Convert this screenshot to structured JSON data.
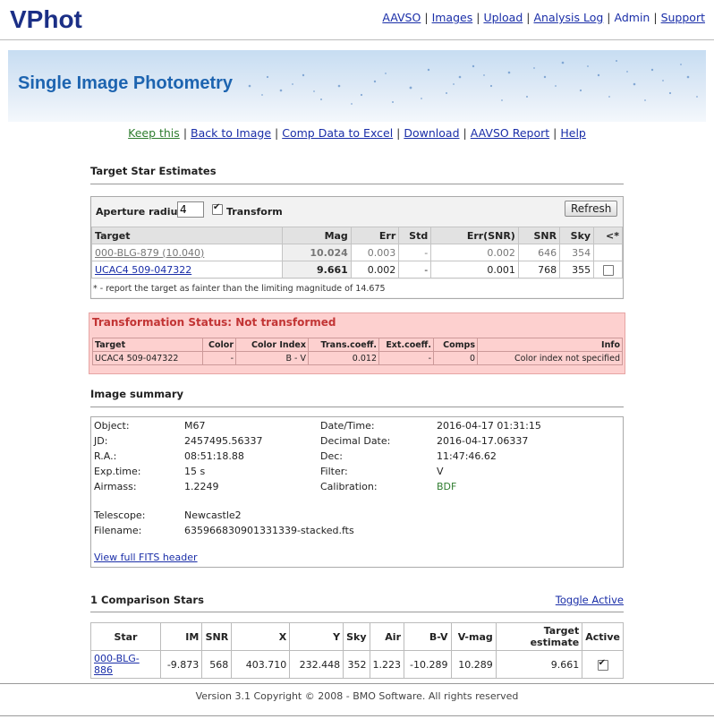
{
  "app": {
    "logo": "VPhot",
    "nav": [
      {
        "label": "AAVSO",
        "link": true
      },
      {
        "label": "Images",
        "link": true
      },
      {
        "label": "Upload",
        "link": true
      },
      {
        "label": "Analysis Log",
        "link": true
      },
      {
        "label": "Admin",
        "link": false
      },
      {
        "label": "Support",
        "link": true
      }
    ]
  },
  "banner": {
    "title": "Single Image Photometry"
  },
  "subnav": [
    "Keep this",
    "Back to Image",
    "Comp Data to Excel",
    "Download",
    "AAVSO Report",
    "Help"
  ],
  "target_section": {
    "title": "Target Star Estimates",
    "aperture_label": "Aperture radius:",
    "aperture_value": "4",
    "transform_label": "Transform",
    "transform_checked": true,
    "refresh_label": "Refresh",
    "columns": [
      "Target",
      "Mag",
      "Err",
      "Std",
      "Err(SNR)",
      "SNR",
      "Sky",
      "<*"
    ],
    "rows": [
      {
        "target": "000-BLG-879 (10.040)",
        "mag": "10.024",
        "err": "0.003",
        "std": "-",
        "err_snr": "0.002",
        "snr": "646",
        "sky": "354",
        "check": false
      },
      {
        "target": "UCAC4 509-047322",
        "mag": "9.661",
        "err": "0.002",
        "std": "-",
        "err_snr": "0.001",
        "snr": "768",
        "sky": "355",
        "check": true
      }
    ],
    "footnote": "* - report the target as fainter than the limiting magnitude of 14.675"
  },
  "transformation": {
    "title": "Transformation Status: Not transformed",
    "columns": [
      "Target",
      "Color",
      "Color Index",
      "Trans.coeff.",
      "Ext.coeff.",
      "Comps",
      "Info"
    ],
    "row": {
      "target": "UCAC4 509-047322",
      "color": "-",
      "color_index": "B - V",
      "trans": "0.012",
      "ext": "-",
      "comps": "0",
      "info": "Color index not specified"
    }
  },
  "summary": {
    "title": "Image summary",
    "left": [
      {
        "k": "Object:",
        "v": "M67"
      },
      {
        "k": "JD:",
        "v": "2457495.56337"
      },
      {
        "k": "R.A.:",
        "v": "08:51:18.88"
      },
      {
        "k": "Exp.time:",
        "v": "15 s"
      },
      {
        "k": "Airmass:",
        "v": "1.2249"
      }
    ],
    "right": [
      {
        "k": "Date/Time:",
        "v": "2016-04-17 01:31:15"
      },
      {
        "k": "Decimal Date:",
        "v": "2016-04-17.06337"
      },
      {
        "k": "Dec:",
        "v": "11:47:46.62"
      },
      {
        "k": "Filter:",
        "v": "V"
      },
      {
        "k": "Calibration:",
        "v": "BDF"
      }
    ],
    "telescope_label": "Telescope:",
    "telescope": "Newcastle2",
    "filename_label": "Filename:",
    "filename": "635966830901331339-stacked.fts",
    "fits_link": "View full FITS header"
  },
  "comparison": {
    "title": "1 Comparison Stars",
    "toggle": "Toggle Active",
    "columns": [
      "Star",
      "IM",
      "SNR",
      "X",
      "Y",
      "Sky",
      "Air",
      "B-V",
      "V-mag",
      "Target estimate",
      "Active"
    ],
    "rows": [
      {
        "star": "000-BLG-886",
        "im": "-9.873",
        "snr": "568",
        "x": "403.710",
        "y": "232.448",
        "sky": "352",
        "air": "1.223",
        "bv": "-10.289",
        "vmag": "10.289",
        "est": "9.661",
        "active": true
      }
    ]
  },
  "footer": "Version 3.1 Copyright © 2008 - BMO Software. All rights reserved",
  "colors": {
    "brand": "#1b2f86",
    "banner_title": "#1d64b0",
    "warn_bg": "#fdd0cf",
    "warn_text": "#c23434",
    "link": "#1a2ea8",
    "calib": "#2f7d2f"
  }
}
